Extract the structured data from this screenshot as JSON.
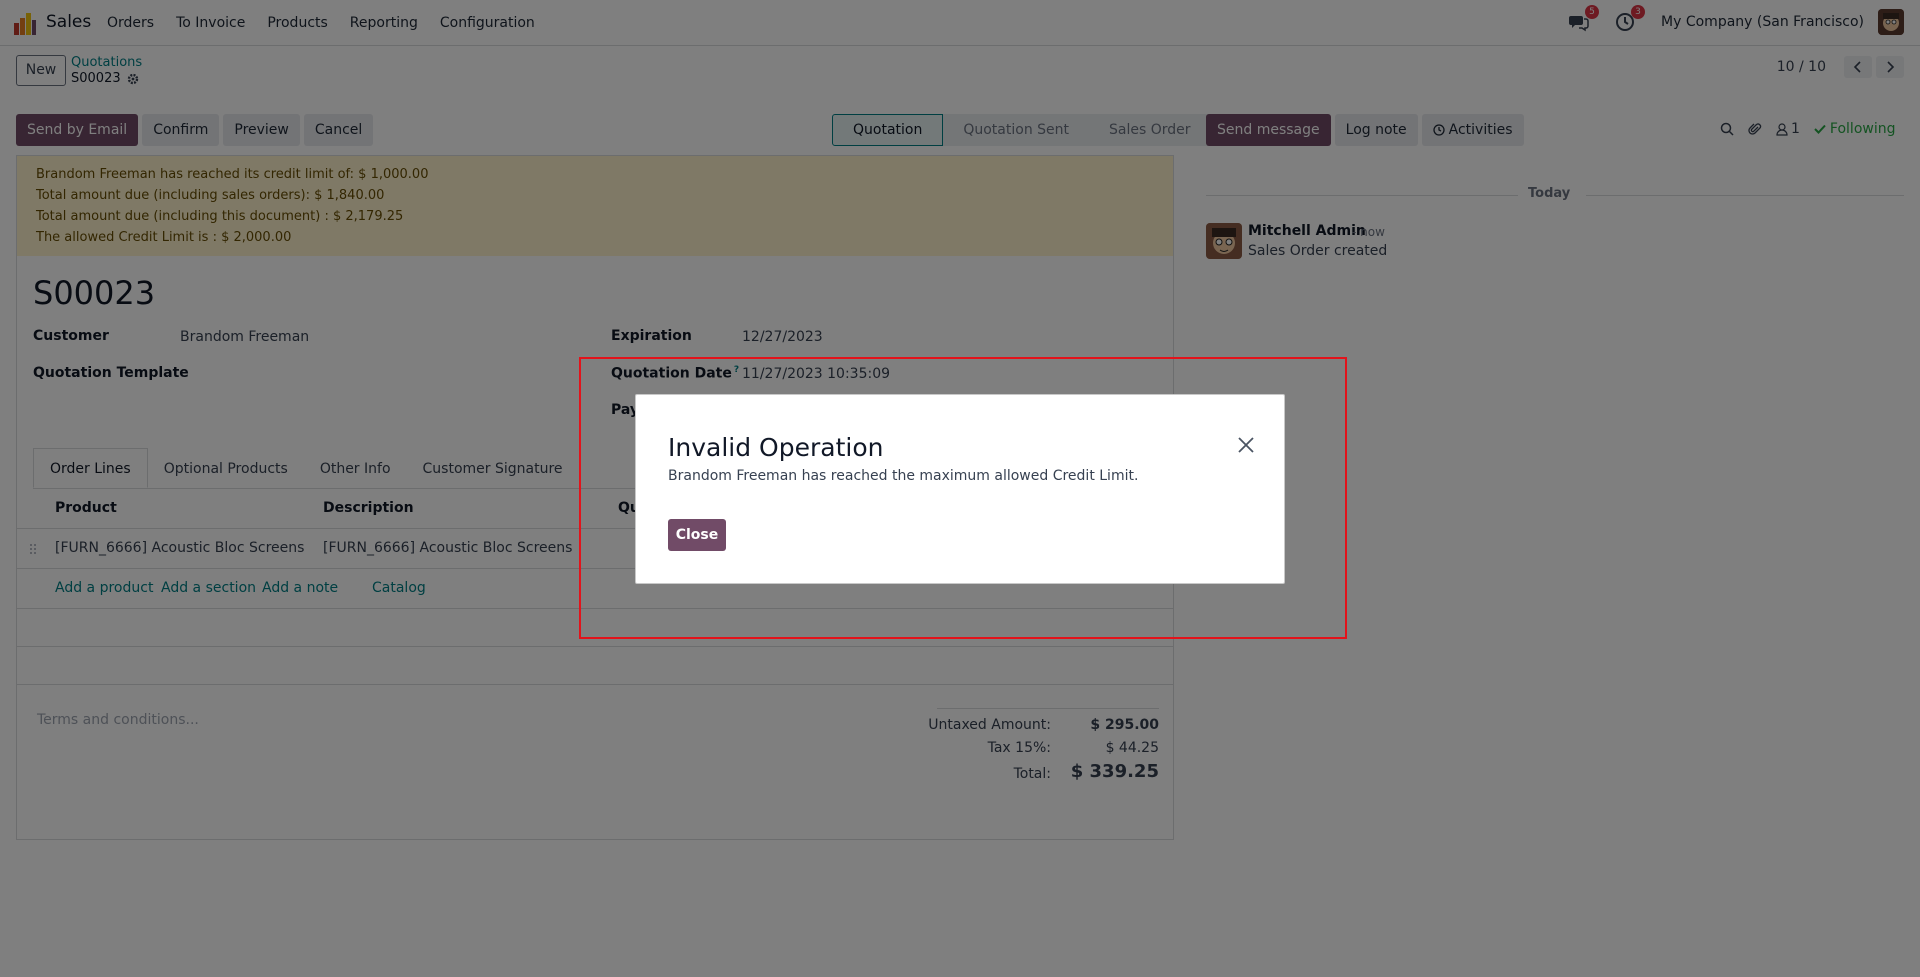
{
  "navbar": {
    "app_name": "Sales",
    "menu": [
      "Orders",
      "To Invoice",
      "Products",
      "Reporting",
      "Configuration"
    ],
    "messages_badge": "5",
    "activities_badge": "3",
    "company": "My Company (San Francisco)"
  },
  "control_panel": {
    "new_label": "New",
    "breadcrumb_parent": "Quotations",
    "breadcrumb_current": "S00023",
    "pager": "10 / 10"
  },
  "actions": {
    "send_email": "Send by Email",
    "confirm": "Confirm",
    "preview": "Preview",
    "cancel": "Cancel"
  },
  "status_stages": [
    "Quotation",
    "Quotation Sent",
    "Sales Order"
  ],
  "alert_lines": [
    "Brandom Freeman has reached its credit limit of: $ 1,000.00",
    "Total amount due (including sales orders): $ 1,840.00",
    "Total amount due (including this document) : $ 2,179.25",
    "The allowed Credit Limit is : $ 2,000.00"
  ],
  "form": {
    "title": "S00023",
    "customer_label": "Customer",
    "customer_value": "Brandom Freeman",
    "template_label": "Quotation Template",
    "expiration_label": "Expiration",
    "expiration_value": "12/27/2023",
    "quotation_date_label": "Quotation Date",
    "quotation_date_help": "?",
    "quotation_date_value": "11/27/2023 10:35:09",
    "payment_label_partial": "Pay"
  },
  "tabs": [
    "Order Lines",
    "Optional Products",
    "Other Info",
    "Customer Signature"
  ],
  "table": {
    "columns": [
      "Product",
      "Description",
      "Qu"
    ],
    "rows": [
      {
        "product": "[FURN_6666] Acoustic Bloc Screens",
        "description": "[FURN_6666] Acoustic Bloc Screens"
      }
    ],
    "add_links": [
      "Add a product",
      "Add a section",
      "Add a note",
      "Catalog"
    ]
  },
  "footer": {
    "terms_placeholder": "Terms and conditions...",
    "untaxed_label": "Untaxed Amount:",
    "untaxed_value": "$ 295.00",
    "tax_label": "Tax 15%:",
    "tax_value": "$ 44.25",
    "total_label": "Total:",
    "total_value": "$ 339.25"
  },
  "chatter": {
    "send_message": "Send message",
    "log_note": "Log note",
    "activities": "Activities",
    "followers_count": "1",
    "following": "Following",
    "today": "Today",
    "author": "Mitchell Admin",
    "time": "- now",
    "body": "Sales Order created"
  },
  "dialog": {
    "title": "Invalid Operation",
    "message": "Brandom Freeman has reached the maximum allowed Credit Limit.",
    "close_label": "Close"
  },
  "colors": {
    "primary": "#714b67",
    "link": "#017e84",
    "alert_bg": "#fff3cd",
    "highlight": "#e3131b",
    "following": "#28a745"
  }
}
